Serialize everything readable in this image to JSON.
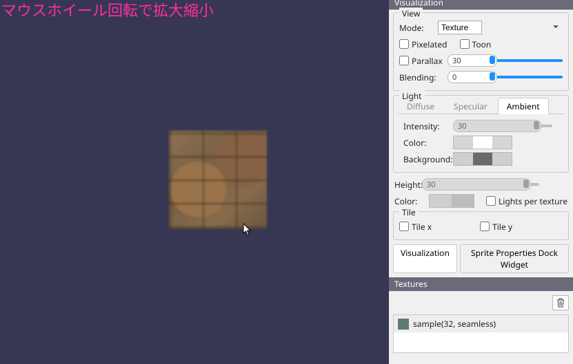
{
  "overlay": "マウスホイール回転で拡大縮小",
  "panelHeader": "Visualization",
  "view": {
    "title": "View",
    "modeLabel": "Mode:",
    "modeValue": "Texture",
    "pixelated": "Pixelated",
    "toon": "Toon",
    "parallaxLabel": "Parallax",
    "parallaxValue": "30",
    "blendingLabel": "Blending:",
    "blendingValue": "0"
  },
  "light": {
    "title": "Light",
    "tabs": {
      "diffuse": "Diffuse",
      "specular": "Specular",
      "ambient": "Ambient"
    },
    "intensityLabel": "Intensity:",
    "intensityValue": "30",
    "colorLabel": "Color:",
    "backgroundLabel": "Background:"
  },
  "heightLabel": "Height:",
  "heightValue": "30",
  "colorLabel2": "Color:",
  "lightsPerTexture": "Lights per texture",
  "tile": {
    "title": "Tile",
    "x": "Tile x",
    "y": "Tile y"
  },
  "bottomTabs": {
    "visualization": "Visualization",
    "sprite": "Sprite Properties Dock Widget"
  },
  "texturesHeader": "Textures",
  "textureItem": "sample(32, seamless)"
}
